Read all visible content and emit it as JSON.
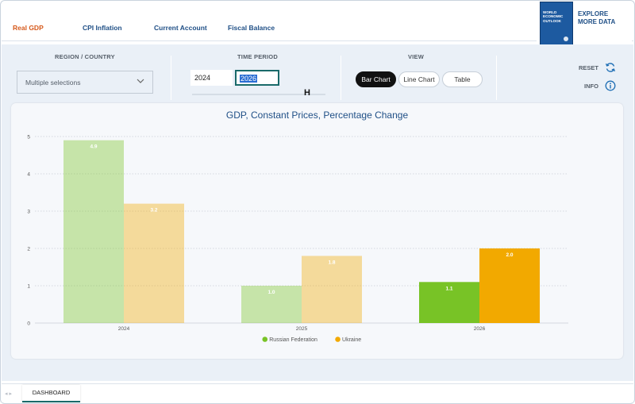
{
  "nav": {
    "items": [
      {
        "label": "Real GDP",
        "active": true
      },
      {
        "label": "CPI Inflation",
        "active": false
      },
      {
        "label": "Current Account",
        "active": false
      },
      {
        "label": "Fiscal Balance",
        "active": false
      }
    ],
    "explore_line1": "EXPLORE",
    "explore_line2": "MORE DATA",
    "book_title": "WORLD\nECONOMIC\nOUTLOOK"
  },
  "controls": {
    "region_label": "REGION / COUNTRY",
    "region_value": "Multiple selections",
    "period_label": "TIME PERIOD",
    "year_start": "2024",
    "year_end": "2026",
    "view_label": "VIEW",
    "views": [
      {
        "label": "Bar Chart",
        "selected": true
      },
      {
        "label": "Line Chart",
        "selected": false
      },
      {
        "label": "Table",
        "selected": false
      }
    ],
    "reset_label": "RESET",
    "info_label": "INFO"
  },
  "chart_data": {
    "type": "bar",
    "title": "GDP, Constant Prices, Percentage Change",
    "categories": [
      "2024",
      "2025",
      "2026"
    ],
    "ylim": [
      0,
      5
    ],
    "yticks": [
      "0",
      "1",
      "2",
      "3",
      "4",
      "5"
    ],
    "grid": true,
    "legend_position": "bottom",
    "series": [
      {
        "name": "Russian Federation",
        "values": [
          4.9,
          1.0,
          1.1
        ],
        "labels": [
          "4.9",
          "1.0",
          "1.1"
        ],
        "color": "#78c326",
        "faded": [
          true,
          true,
          false
        ]
      },
      {
        "name": "Ukraine",
        "values": [
          3.2,
          1.8,
          2.0
        ],
        "labels": [
          "3.2",
          "1.8",
          "2.0"
        ],
        "color": "#f2a900",
        "faded": [
          true,
          true,
          false
        ]
      }
    ]
  },
  "footer": {
    "tab_label": "DASHBOARD",
    "prev_arrow": "◂",
    "next_arrow": "▸"
  }
}
